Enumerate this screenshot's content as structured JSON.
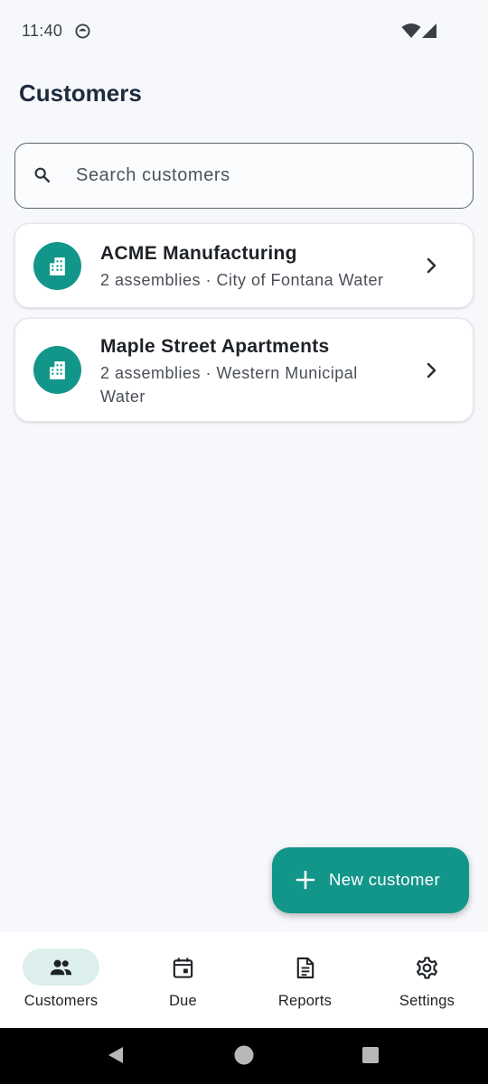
{
  "status_bar": {
    "time": "11:40",
    "icons": [
      "app-notification-icon",
      "wifi-icon",
      "cell-signal-icon"
    ]
  },
  "header": {
    "title": "Customers"
  },
  "search": {
    "placeholder": "Search customers",
    "value": "",
    "icon": "search-icon"
  },
  "customers": [
    {
      "name": "ACME Manufacturing",
      "subtitle": "2 assemblies · City of Fontana Water",
      "icon": "building-icon"
    },
    {
      "name": "Maple Street Apartments",
      "subtitle": "2 assemblies · Western Municipal Water",
      "icon": "building-icon"
    }
  ],
  "fab": {
    "label": "New customer",
    "icon": "plus-icon"
  },
  "bottom_nav": {
    "items": [
      {
        "label": "Customers",
        "icon": "people-icon",
        "selected": true
      },
      {
        "label": "Due",
        "icon": "calendar-icon",
        "selected": false
      },
      {
        "label": "Reports",
        "icon": "document-icon",
        "selected": false
      },
      {
        "label": "Settings",
        "icon": "gear-icon",
        "selected": false
      }
    ]
  },
  "colors": {
    "accent": "#13968a",
    "selected_pill": "#dcefed",
    "background": "#f7f8fc",
    "title_text": "#1d2b3d"
  }
}
